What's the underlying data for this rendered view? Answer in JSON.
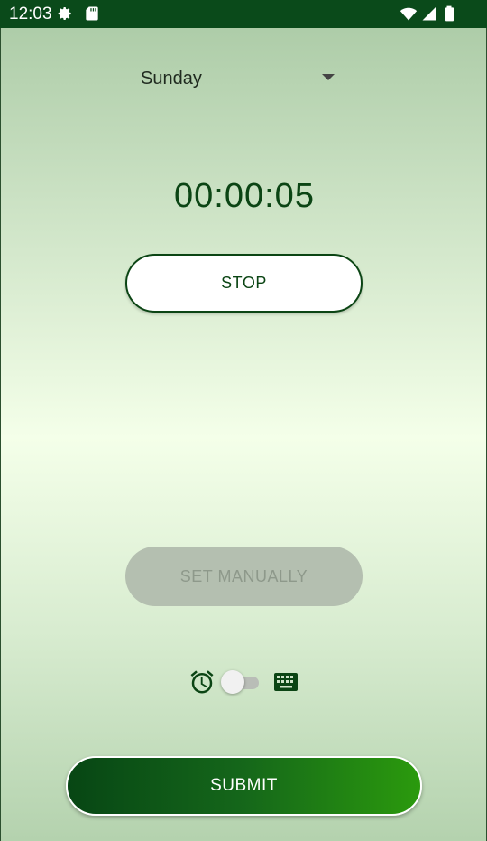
{
  "status_bar": {
    "time": "12:03"
  },
  "day_select": {
    "selected": "Sunday"
  },
  "timer": {
    "value": "00:00:05"
  },
  "buttons": {
    "stop": "STOP",
    "set_manually": "SET MANUALLY",
    "submit": "SUBMIT"
  },
  "mode_toggle": {
    "left_icon": "alarm-clock-icon",
    "right_icon": "keyboard-icon",
    "on": false
  },
  "colors": {
    "primary": "#0b4514",
    "submit_gradient_start": "#074614",
    "submit_gradient_end": "#2b9a0d",
    "disabled_button": "#b4bfb0"
  }
}
